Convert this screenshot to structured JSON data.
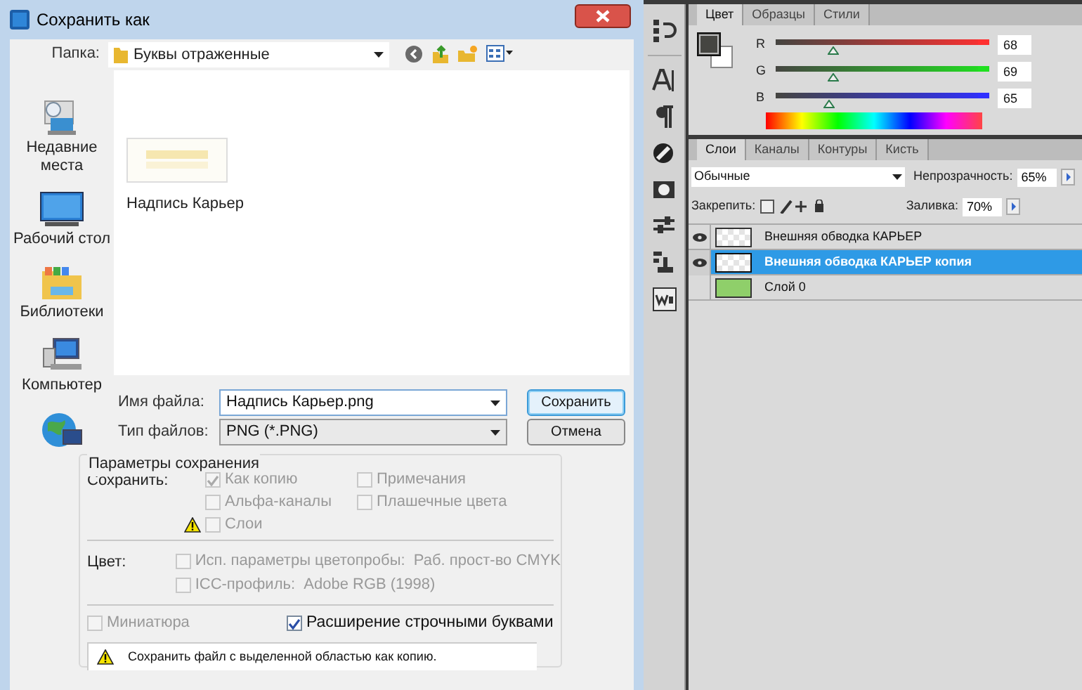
{
  "dialog": {
    "title": "Сохранить как",
    "folder_label": "Папка:",
    "folder": "Буквы отраженные",
    "places": [
      {
        "kind": "recent",
        "label": "Недавние места"
      },
      {
        "kind": "desktop",
        "label": "Рабочий стол"
      },
      {
        "kind": "libraries",
        "label": "Библиотеки"
      },
      {
        "kind": "computer",
        "label": "Компьютер"
      },
      {
        "kind": "network"
      }
    ],
    "files": [
      {
        "name": "Надпись Карьер"
      }
    ],
    "filename_label": "Имя файла:",
    "filename": "Надпись Карьер.png",
    "filetype_label": "Тип файлов:",
    "filetype": "PNG (*.PNG)",
    "buttons": [
      {
        "label": "Сохранить",
        "default": true
      },
      {
        "label": "Отмена",
        "default": false
      }
    ],
    "options": {
      "title": "Параметры сохранения",
      "save_label": "Сохранить:",
      "save_checks": [
        {
          "label": "Как копию",
          "checked": true,
          "disabled": true,
          "warning": false
        },
        {
          "label": "Примечания",
          "checked": false,
          "disabled": true,
          "warning": false
        },
        {
          "label": "Альфа-каналы",
          "checked": false,
          "disabled": true,
          "warning": false
        },
        {
          "label": "Плашечные цвета",
          "checked": false,
          "disabled": true,
          "warning": false
        },
        {
          "label": "Слои",
          "checked": false,
          "disabled": true,
          "warning": true
        }
      ],
      "color_label": "Цвет:",
      "color_checks": [
        {
          "label": "Исп. параметры цветопробы:  Раб. прост-во CMYK",
          "checked": false,
          "disabled": true
        },
        {
          "label": "ICC-профиль:  Adobe RGB (1998)",
          "checked": false,
          "disabled": true
        }
      ],
      "bottom_checks": [
        {
          "label": "Миниатюра",
          "checked": false,
          "disabled": true
        },
        {
          "label": "Расширение строчными буквами",
          "checked": true,
          "disabled": false
        }
      ],
      "message": "Сохранить файл с выделенной областью как копию."
    }
  },
  "color_panel": {
    "tabs": [
      {
        "label": "Цвет",
        "selected": true
      },
      {
        "label": "Образцы",
        "selected": false
      },
      {
        "label": "Стили",
        "selected": false
      }
    ],
    "channels": [
      {
        "label": "R",
        "level": 0.27,
        "value": "68",
        "color": "#ff3030"
      },
      {
        "label": "G",
        "level": 0.27,
        "value": "69",
        "color": "#20e020"
      },
      {
        "label": "B",
        "level": 0.25,
        "value": "65",
        "color": "#3030ff"
      }
    ]
  },
  "layers_panel": {
    "tabs": [
      {
        "label": "Слои",
        "selected": true
      },
      {
        "label": "Каналы",
        "selected": false
      },
      {
        "label": "Контуры",
        "selected": false
      },
      {
        "label": "Кисть",
        "selected": false
      }
    ],
    "blend_mode": "Обычные",
    "opacity_label": "Непрозрачность:",
    "opacity": "65%",
    "lock_label": "Закрепить:",
    "fill_label": "Заливка:",
    "fill": "70%",
    "layers": [
      {
        "name": "Внешняя обводка КАРЬЕР",
        "visible": true,
        "selected": false,
        "kind": "transparent"
      },
      {
        "name": "Внешняя обводка КАРЬЕР копия",
        "visible": true,
        "selected": true,
        "kind": "transparent"
      },
      {
        "name": "Слой 0",
        "visible": false,
        "selected": false,
        "kind": "fill"
      }
    ]
  }
}
